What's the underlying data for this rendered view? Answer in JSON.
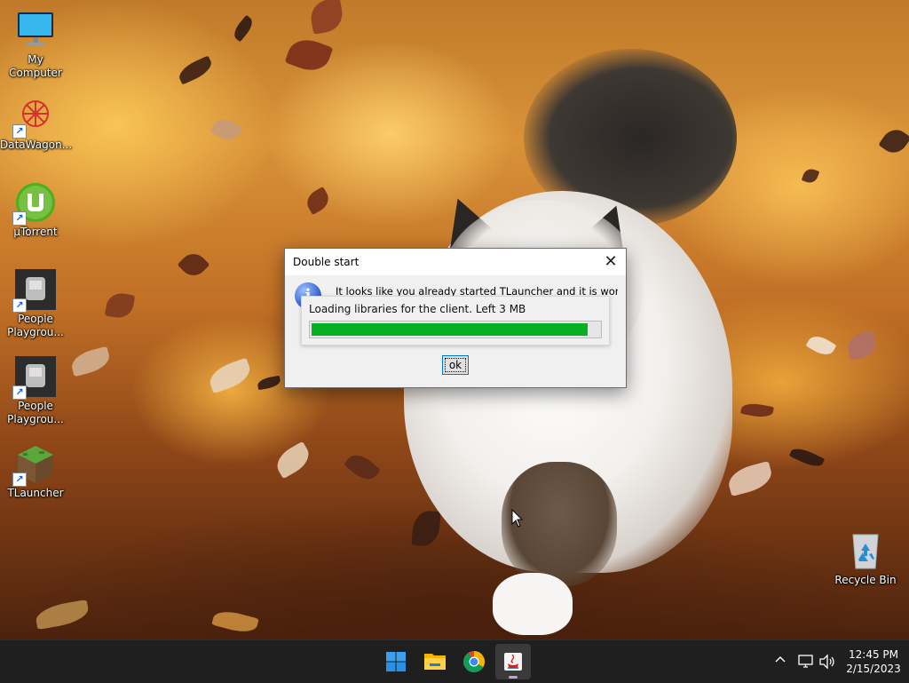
{
  "desktop": {
    "icons": [
      {
        "name": "My Computer",
        "icon": "monitor-icon"
      },
      {
        "name": "DataWagon...",
        "icon": "datawagon-icon"
      },
      {
        "name": "µTorrent",
        "icon": "utorrent-icon"
      },
      {
        "name": "People\nPlaygrou...",
        "icon": "people-playground-icon"
      },
      {
        "name": "People\nPlaygrou...",
        "icon": "people-playground-icon"
      },
      {
        "name": "TLauncher",
        "icon": "tlauncher-icon"
      },
      {
        "name": "Recycle Bin",
        "icon": "recycle-bin-icon"
      }
    ]
  },
  "dialog": {
    "title": "Double start",
    "message": "It looks like you already started TLauncher and it is working.",
    "progress_label": "Loading libraries for the client. Left 3 MB",
    "progress_fraction": 0.96,
    "progress_color": "#06b025",
    "ok_label": "ok"
  },
  "taskbar": {
    "apps": [
      {
        "icon": "windows-start-icon"
      },
      {
        "icon": "file-explorer-icon"
      },
      {
        "icon": "chrome-icon"
      },
      {
        "icon": "java-icon",
        "active": true
      }
    ],
    "tray": {
      "chevron": "^",
      "time": "12:45 PM",
      "date": "2/15/2023"
    }
  }
}
